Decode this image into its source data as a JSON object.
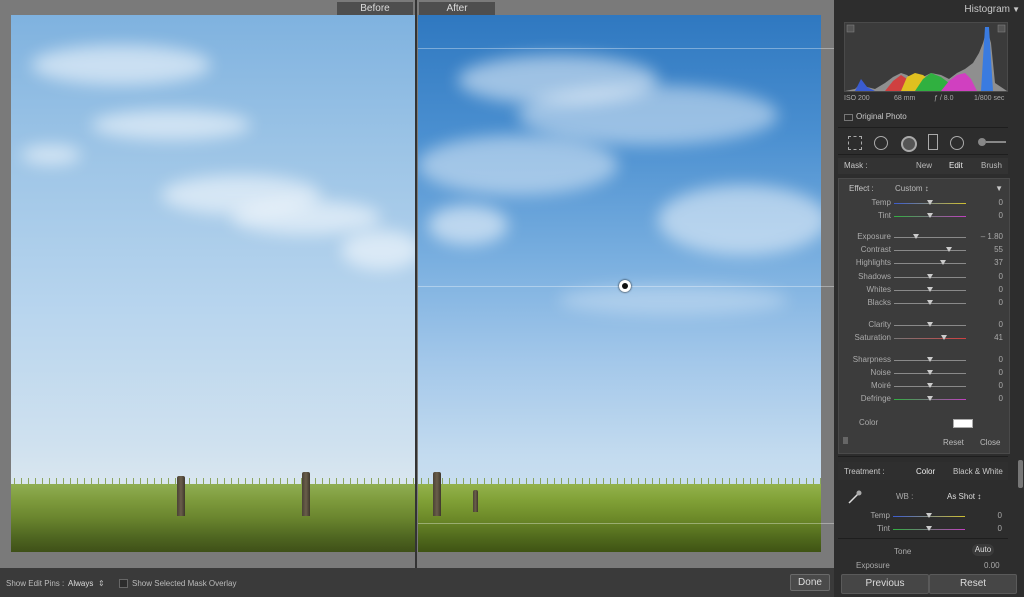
{
  "view": {
    "before_label": "Before",
    "after_label": "After"
  },
  "toolbar": {
    "show_edit_pins_label": "Show Edit Pins :",
    "show_edit_pins_value": "Always",
    "show_mask_overlay_label": "Show Selected Mask Overlay",
    "done_label": "Done"
  },
  "panel": {
    "title": "Histogram",
    "iso": "ISO 200",
    "focal": "68 mm",
    "aperture": "ƒ / 8.0",
    "shutter": "1/800 sec",
    "original_photo": "Original Photo",
    "mask": {
      "label": "Mask :",
      "new": "New",
      "edit": "Edit",
      "brush": "Brush"
    },
    "effect": {
      "label": "Effect :",
      "value": "Custom ↕"
    },
    "sliders": [
      {
        "name": "Temp",
        "value": "0",
        "pos": 0.5
      },
      {
        "name": "Tint",
        "value": "0",
        "pos": 0.5
      },
      {
        "name": "Exposure",
        "value": "– 1.80",
        "pos": 0.3
      },
      {
        "name": "Contrast",
        "value": "55",
        "pos": 0.77
      },
      {
        "name": "Highlights",
        "value": "37",
        "pos": 0.68
      },
      {
        "name": "Shadows",
        "value": "0",
        "pos": 0.5
      },
      {
        "name": "Whites",
        "value": "0",
        "pos": 0.5
      },
      {
        "name": "Blacks",
        "value": "0",
        "pos": 0.5
      },
      {
        "name": "Clarity",
        "value": "0",
        "pos": 0.5
      },
      {
        "name": "Saturation",
        "value": "41",
        "pos": 0.7
      },
      {
        "name": "Sharpness",
        "value": "0",
        "pos": 0.5
      },
      {
        "name": "Noise",
        "value": "0",
        "pos": 0.5
      },
      {
        "name": "Moiré",
        "value": "0",
        "pos": 0.5
      },
      {
        "name": "Defringe",
        "value": "0",
        "pos": 0.5
      }
    ],
    "color_label": "Color",
    "effect_reset": "Reset",
    "effect_close": "Close",
    "treatment": {
      "label": "Treatment :",
      "color": "Color",
      "bw": "Black & White"
    },
    "wb": {
      "label": "WB :",
      "value": "As Shot ↕"
    },
    "basic_sliders": [
      {
        "name": "Temp",
        "value": "0",
        "pos": 0.5
      },
      {
        "name": "Tint",
        "value": "0",
        "pos": 0.5
      }
    ],
    "tone_label": "Tone",
    "auto_label": "Auto",
    "exposure_partial": {
      "name": "Exposure",
      "value": "0.00"
    },
    "previous_label": "Previous",
    "reset_label": "Reset"
  }
}
